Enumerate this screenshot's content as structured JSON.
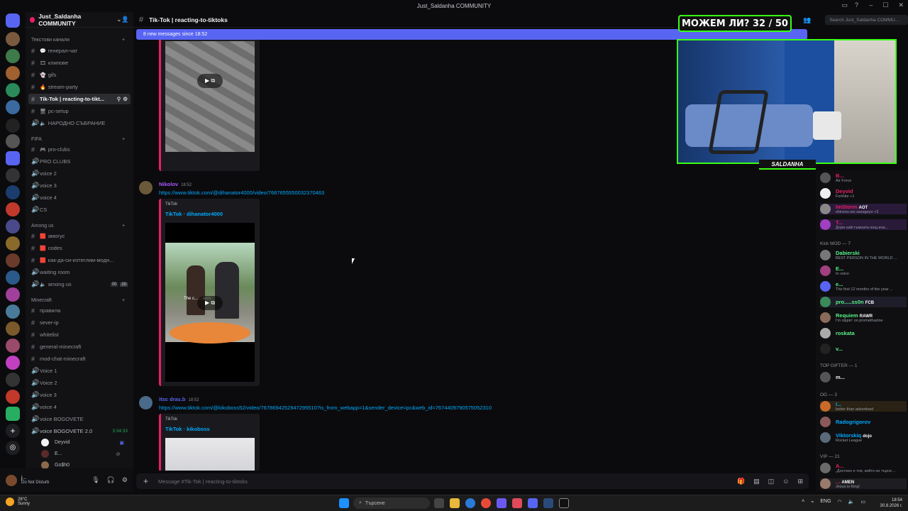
{
  "window": {
    "title": "Just_Saldanha COMMUNITY"
  },
  "server": {
    "name": "Just_Saldanha COMMUNITY"
  },
  "categories": {
    "text": "Текстови канали",
    "fifa": "FIFA",
    "among": "Among us",
    "minecraft": "Minecraft"
  },
  "channels": {
    "general": "генерал-чат",
    "clips": "клипове",
    "gifs": "gifs",
    "stream_party": "stream-party",
    "tiktok": "Tik-Tok | reacting-to-tikt...",
    "pc_setup": "pc-setup",
    "narodno": "НАРОДНО СЪБРАНИЕ",
    "pro_clubs_text": "pro-clubs",
    "pro_clubs_voice": "PRO CLUBS",
    "voice2": "voice 2",
    "voice3": "voice 3",
    "voice4": "voice 4",
    "cs": "CS",
    "amogus": "амогус",
    "codes": "codes",
    "kak": "как-да-си-изтеглим-модн...",
    "waiting": "waiting room",
    "among_us": "among us",
    "among_us_counts": [
      "00",
      "20"
    ],
    "pravila": "правила",
    "server_ip": "sever-ip",
    "whitelist": "whitelist",
    "general_mc": "general-minecraft",
    "mod_chat": "mod-chat-minecraft",
    "voice1_mc": "Voice 1",
    "voice2_mc": "Voice 2",
    "voice3_mc": "voice 3",
    "voice4_mc": "voice 4",
    "bogovete": "voice BOGOVETE",
    "bogovete2": "voice BOGOVETE 2.0",
    "bogovete2_time": "3:34:33"
  },
  "voice_users": [
    "Deyvid",
    "E...",
    "Go$h0"
  ],
  "user_panel": {
    "name": "j...",
    "status": "Do Not Disturb"
  },
  "chat": {
    "channel_title": "Tik-Tok | reacting-to-tiktoks",
    "new_messages": "8 new messages since 18:52",
    "input_placeholder": "Message #Tik-Tok | reacting-to-tiktoks",
    "messages": [
      {
        "author": "Nikolov",
        "time": "18:52",
        "link": "https://www.tiktok.com/@dihanator4000/video/7667655550032370463",
        "provider": "TikTok",
        "embed_title": "TikTok · dihanator4000",
        "caption": "The c...     ...ours"
      },
      {
        "author": "itsc dras.b",
        "time": "18:52",
        "link": "https://www.tiktok.com/@kikoboss52/video/7678694252947295510?is_from_webapp=1&sender_device=pc&web_id=7674409790575052310",
        "provider": "TikTok",
        "embed_title": "TikTok · kikoboss"
      }
    ]
  },
  "search": {
    "placeholder": "Search Just_Saldanha COMMU..."
  },
  "overlay": {
    "title": "МОЖЕМ ЛИ? 32 / 50",
    "cam_label": "SALDANHA"
  },
  "members": {
    "groups": [
      {
        "label": "Kick MOD — 7"
      },
      {
        "label": "TOP GIFTER — 1"
      },
      {
        "label": "OG — 3"
      },
      {
        "label": "VIP — 21"
      }
    ],
    "rows": [
      {
        "name": "B...",
        "sub": "Air Force",
        "color": "#e91e63"
      },
      {
        "name": "Deyvid",
        "sub": "Fortnite +1",
        "color": "#e91e63"
      },
      {
        "name": "ImStorm",
        "badge": "AOT",
        "sub": "shinzou wo sasageyo <3",
        "color": "#e91e63"
      },
      {
        "name": "T...",
        "sub": "Дори най-тъмната нощ ина...",
        "color": "#e91e63"
      },
      {
        "name": "Dabierski",
        "sub": "BEST PERSON IN THE WORLD ...",
        "color": "#57f287"
      },
      {
        "name": "E...",
        "sub": "In voice",
        "color": "#57f287"
      },
      {
        "name": "e...",
        "sub": "The first 12 months of the year ...",
        "color": "#57f287"
      },
      {
        "name": "pro.....ss0n",
        "badge": "FCB",
        "sub": "",
        "color": "#57f287"
      },
      {
        "name": "Requiem",
        "badge": "RAWR",
        "sub": "I'm sippin' on promethazine",
        "color": "#57f287"
      },
      {
        "name": "roskata",
        "sub": "",
        "color": "#57f287"
      },
      {
        "name": "v...",
        "sub": "",
        "color": "#57f287"
      },
      {
        "name": "m...",
        "sub": "",
        "color": "#f2f3f5"
      },
      {
        "name": "I...",
        "sub": "better than advertised",
        "color": "#00a8fc"
      },
      {
        "name": "Radogrigorov",
        "sub": "",
        "color": "#00a8fc"
      },
      {
        "name": "Viktorskiq",
        "badge": "dojo",
        "sub": "Rocket League",
        "color": "#00a8fc"
      },
      {
        "name": "A...",
        "sub": "„Достоен е тоя, който не търси ...",
        "color": "#e91e63"
      },
      {
        "name": "...",
        "badge": "AMEN",
        "sub": "Jesus is King!",
        "color": "#e91e63"
      }
    ]
  },
  "taskbar": {
    "weather_temp": "28°C",
    "weather_desc": "Sunny",
    "search": "Търсене",
    "lang": "ENG",
    "time": "18:54",
    "date": "30.8.2026 г."
  }
}
